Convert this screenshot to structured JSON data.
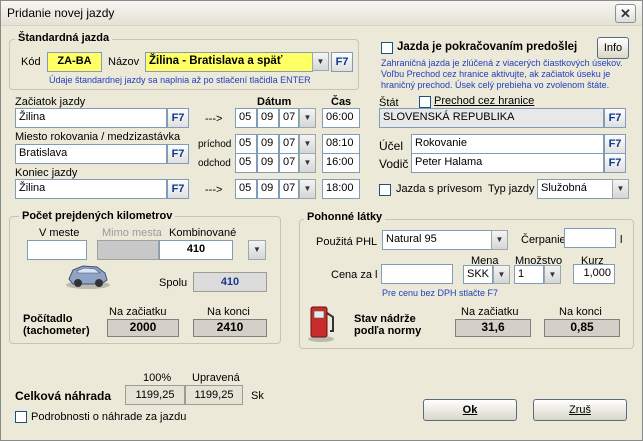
{
  "window": {
    "title": "Pridanie novej jazdy",
    "close": "✕"
  },
  "standard": {
    "section": "Štandardná jazda",
    "code_label": "Kód",
    "code": "ZA-BA",
    "name_label": "Názov",
    "name": "Žilina - Bratislava a späť",
    "hint": "Údaje štandardnej jazdy sa naplnia až po stlačení tlačidla ENTER"
  },
  "continuation": {
    "checkbox": "Jazda je pokračovaním predošlej",
    "info_button": "Info",
    "text1": "Zahraničná jazda je zlúčená z viacerých čiastkových úsekov.",
    "text2": "Voľbu Prechod cez hranice aktivujte, ak začiatok úseku je",
    "text3": "hraničný prechod. Úsek celý prebieha vo zvolenom štáte."
  },
  "trip": {
    "start_label": "Začiatok jazdy",
    "start": "Žilina",
    "meeting_label": "Miesto rokovania / medzizastávka",
    "meeting": "Bratislava",
    "end_label": "Koniec jazdy",
    "end": "Žilina",
    "date_label": "Dátum",
    "time_label": "Čas",
    "arrow": "--->",
    "arrival_label": "príchod",
    "departure_label": "odchod",
    "rows": [
      {
        "day": "05",
        "month": "09",
        "year": "07",
        "time": "06:00"
      },
      {
        "day": "05",
        "month": "09",
        "year": "07",
        "time": "08:10"
      },
      {
        "day": "05",
        "month": "09",
        "year": "07",
        "time": "16:00"
      },
      {
        "day": "05",
        "month": "09",
        "year": "07",
        "time": "18:00"
      }
    ]
  },
  "state": {
    "label": "Štát",
    "border_checkbox": "Prechod cez hranice",
    "value": "SLOVENSKÁ REPUBLIKA",
    "purpose_label": "Účel",
    "purpose": "Rokovanie",
    "driver_label": "Vodič",
    "driver": "Peter Halama",
    "trailer_checkbox": "Jazda s prívesom",
    "type_label": "Typ jazdy",
    "type": "Služobná"
  },
  "km": {
    "section": "Počet prejdených kilometrov",
    "city_label": "V meste",
    "outside_label": "Mimo mesta",
    "combined_label": "Kombinované",
    "combined": "410",
    "total_label": "Spolu",
    "total": "410",
    "counter_label_1": "Počítadlo",
    "counter_label_2": "(tachometer)",
    "start_label": "Na začiatku",
    "start": "2000",
    "end_label": "Na konci",
    "end": "2410"
  },
  "fuel": {
    "section": "Pohonné látky",
    "phl_label": "Použitá PHL",
    "phl": "Natural 95",
    "draw_label": "Čerpanie",
    "draw_unit": "l",
    "price_label": "Cena za l",
    "currency_label": "Mena",
    "currency": "SKK",
    "qty_label": "Množstvo",
    "qty": "1",
    "rate_label": "Kurz",
    "rate": "1,000",
    "vat_hint": "Pre cenu bez DPH stlačte F7",
    "tank_label_1": "Stav nádrže",
    "tank_label_2": "podľa normy",
    "tank_start_label": "Na začiatku",
    "tank_start": "31,6",
    "tank_end_label": "Na konci",
    "tank_end": "0,85"
  },
  "compensation": {
    "label": "Celková náhrada",
    "col100_label": "100%",
    "col100": "1199,25",
    "adjusted_label": "Upravená",
    "adjusted": "1199,25",
    "unit": "Sk",
    "details_checkbox": "Podrobnosti o náhrade za jazdu"
  },
  "buttons": {
    "ok": "Ok",
    "cancel": "Zruš",
    "f7": "F7"
  }
}
